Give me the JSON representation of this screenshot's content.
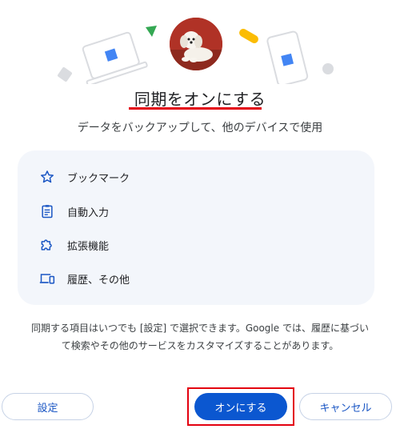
{
  "dialog": {
    "title": "同期をオンにする",
    "subtitle": "データをバックアップして、他のデバイスで使用",
    "items": [
      {
        "label": "ブックマーク",
        "icon": "star-icon"
      },
      {
        "label": "自動入力",
        "icon": "clipboard-icon"
      },
      {
        "label": "拡張機能",
        "icon": "puzzle-icon"
      },
      {
        "label": "履歴、その他",
        "icon": "devices-icon"
      }
    ],
    "footnote_line1": "同期する項目はいつでも [設定] で選択できます。Google では、履歴に基づい",
    "footnote_line2": "て検索やその他のサービスをカスタマイズすることがあります。",
    "buttons": {
      "settings": "設定",
      "turn_on": "オンにする",
      "cancel": "キャンセル"
    }
  },
  "colors": {
    "accent": "#0b57d0",
    "highlight": "#e3000f",
    "card_bg": "#f3f6fb",
    "icon": "#1a56c4"
  }
}
